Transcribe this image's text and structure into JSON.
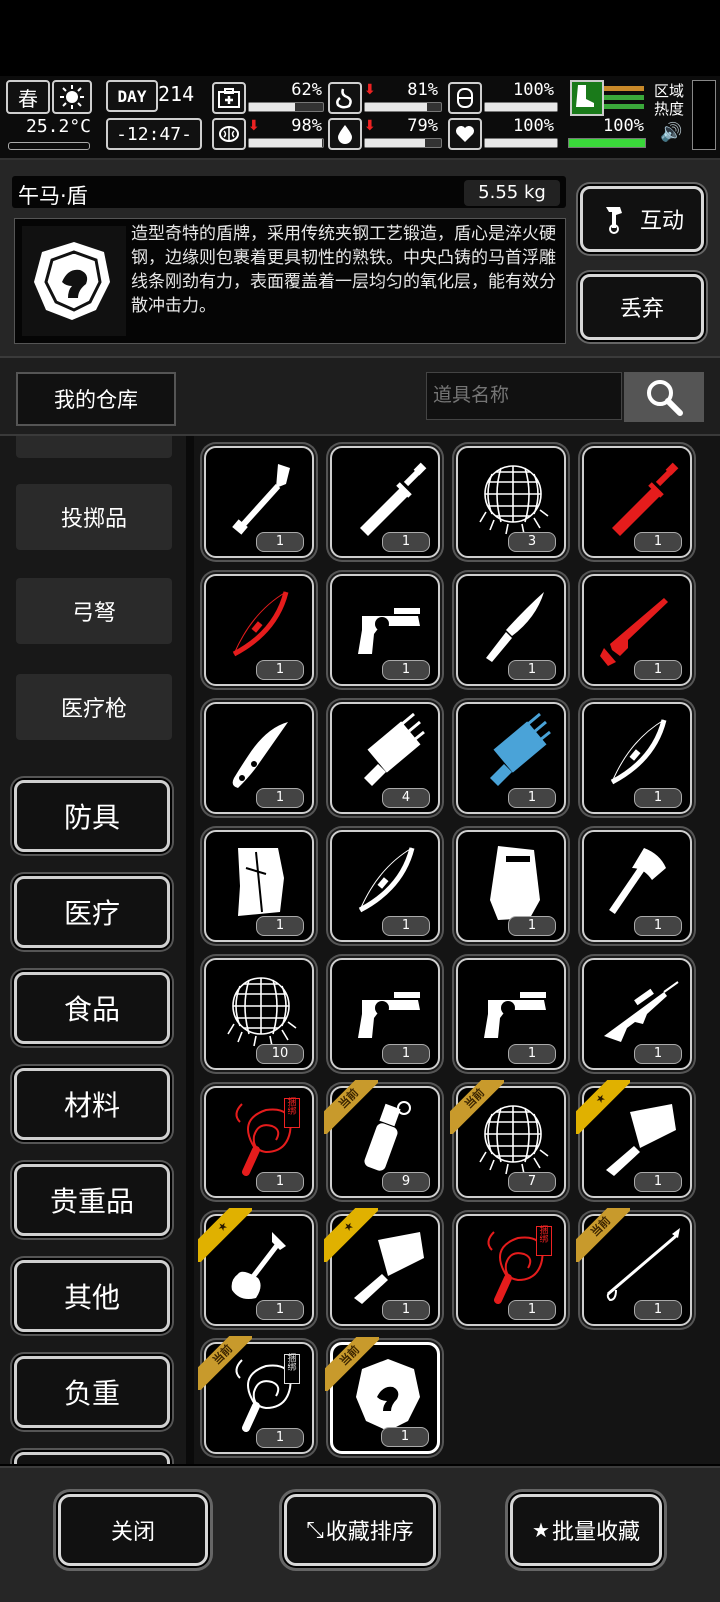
{
  "hud": {
    "season": "春",
    "temperature": "25.2°C",
    "day_label": "DAY",
    "day_number": "214",
    "time": "-12:47-",
    "health_pct": "62%",
    "hunger_pct": "81%",
    "armor_pct": "100%",
    "mind_pct": "98%",
    "thirst_pct": "79%",
    "heart_pct": "100%",
    "stamina_pct": "100%",
    "zone_heat_label": "区域热度",
    "values": {
      "health": 62,
      "hunger": 81,
      "armor": 100,
      "mind": 98,
      "thirst": 79,
      "heart": 100,
      "stamina": 100
    }
  },
  "item": {
    "name": "午马·盾",
    "weight": "5.55 kg",
    "description": "造型奇特的盾牌，采用传统夹钢工艺锻造，盾心是淬火硬钢，边缘则包裹着更具韧性的熟铁。中央凸铸的马首浮雕线条刚劲有力，表面覆盖着一层均匀的氧化层，能有效分散冲击力。"
  },
  "actions": {
    "interact": "互动",
    "discard": "丢弃"
  },
  "warehouse": {
    "label": "我的仓库",
    "search_placeholder": "道具名称"
  },
  "categories": {
    "small": [
      "投掷品",
      "弓弩",
      "医疗枪"
    ],
    "big": [
      "防具",
      "医疗",
      "食品",
      "材料",
      "贵重品",
      "其他",
      "负重"
    ]
  },
  "tags": {
    "current": "当前",
    "tie": "捆绑"
  },
  "grid": [
    {
      "icon": "shovel",
      "count": "1",
      "color": "#fff"
    },
    {
      "icon": "broadsword",
      "count": "1",
      "color": "#fff"
    },
    {
      "icon": "net",
      "count": "3",
      "color": "#fff"
    },
    {
      "icon": "broadsword",
      "count": "1",
      "color": "#e51c1c"
    },
    {
      "icon": "bow",
      "count": "1",
      "color": "#e51c1c"
    },
    {
      "icon": "revolver",
      "count": "1",
      "color": "#fff"
    },
    {
      "icon": "knife",
      "count": "1",
      "color": "#fff"
    },
    {
      "icon": "rifle",
      "count": "1",
      "color": "#e51c1c"
    },
    {
      "icon": "folding-knife",
      "count": "1",
      "color": "#fff"
    },
    {
      "icon": "minigun",
      "count": "4",
      "color": "#fff"
    },
    {
      "icon": "minigun",
      "count": "1",
      "color": "#4aa3d8"
    },
    {
      "icon": "bow",
      "count": "1",
      "color": "#fff"
    },
    {
      "icon": "board",
      "count": "1",
      "color": "#fff"
    },
    {
      "icon": "bow",
      "count": "1",
      "color": "#fff"
    },
    {
      "icon": "riot-shield",
      "count": "1",
      "color": "#fff"
    },
    {
      "icon": "axe",
      "count": "1",
      "color": "#fff"
    },
    {
      "icon": "net",
      "count": "10",
      "color": "#fff"
    },
    {
      "icon": "revolver",
      "count": "1",
      "color": "#fff"
    },
    {
      "icon": "revolver",
      "count": "1",
      "color": "#fff"
    },
    {
      "icon": "sniper",
      "count": "1",
      "color": "#fff"
    },
    {
      "icon": "whip",
      "count": "1",
      "color": "#e51c1c",
      "tag": "red"
    },
    {
      "icon": "grenade",
      "count": "9",
      "color": "#fff",
      "badge": "current"
    },
    {
      "icon": "net",
      "count": "7",
      "color": "#fff",
      "badge": "current"
    },
    {
      "icon": "cleaver",
      "count": "1",
      "color": "#fff",
      "badge": "star"
    },
    {
      "icon": "spade",
      "count": "1",
      "color": "#fff",
      "badge": "star"
    },
    {
      "icon": "cleaver",
      "count": "1",
      "color": "#fff",
      "badge": "star"
    },
    {
      "icon": "whip",
      "count": "1",
      "color": "#e51c1c",
      "tag": "red"
    },
    {
      "icon": "spear",
      "count": "1",
      "color": "#fff",
      "badge": "current"
    },
    {
      "icon": "whip",
      "count": "1",
      "color": "#fff",
      "badge": "current",
      "tag": "white"
    },
    {
      "icon": "shield",
      "count": "1",
      "color": "#fff",
      "badge": "current",
      "selected": true
    }
  ],
  "bottom": {
    "close": "关闭",
    "sort": "收藏排序",
    "batch": "批量收藏"
  }
}
